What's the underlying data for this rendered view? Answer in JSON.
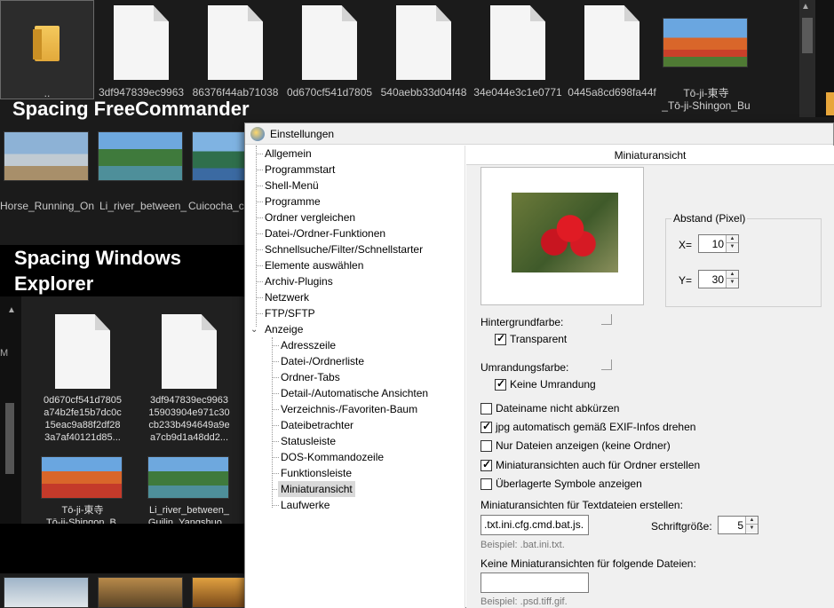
{
  "background": {
    "fc_items": [
      {
        "label": "..",
        "kind": "folder"
      },
      {
        "label": "3df947839ec9963",
        "kind": "doc"
      },
      {
        "label": "86376f44ab71038",
        "kind": "doc"
      },
      {
        "label": "0d670cf541d7805",
        "kind": "doc"
      },
      {
        "label": "540aebb33d04f48",
        "kind": "doc"
      },
      {
        "label": "34e044e3c1e0771",
        "kind": "doc"
      },
      {
        "label": "0445a8cd698fa44f",
        "kind": "doc"
      }
    ],
    "fc_pagoda_label_1": "Tō-ji-東寺",
    "fc_pagoda_label_2": "_Tō-ji-Shingon_Bu",
    "heading_freecommander": "Spacing FreeCommander",
    "row2_captions": [
      "Horse_Running_On",
      "Li_river_between_",
      "Cuicocha_c"
    ],
    "heading_windows_explorer_1": "Spacing Windows",
    "heading_windows_explorer_2": "Explorer",
    "we_side_letter": "M",
    "we_doc1_lines": [
      "0d670cf541d7805",
      "a74b2fe15b7dc0c",
      "15eac9a88f2df28",
      "3a7af40121d85..."
    ],
    "we_doc2_lines": [
      "3df947839ec9963",
      "15903904e971c30",
      "cb233b494649a9e",
      "a7cb9d1a48dd2..."
    ],
    "we_img1_lines": [
      "Tō-ji-東寺",
      "_Tō-ji-Shingon_B..."
    ],
    "we_img2_lines": [
      "Li_river_between_",
      "Guilin_Yangshuo..."
    ]
  },
  "dialog": {
    "title": "Einstellungen",
    "tree_top": [
      "Allgemein",
      "Programmstart",
      "Shell-Menü",
      "Programme",
      "Ordner vergleichen",
      "Datei-/Ordner-Funktionen",
      "Schnellsuche/Filter/Schnellstarter",
      "Elemente auswählen",
      "Archiv-Plugins",
      "Netzwerk",
      "FTP/SFTP"
    ],
    "tree_parent": "Anzeige",
    "tree_children": [
      "Adresszeile",
      "Datei-/Ordnerliste",
      "Ordner-Tabs",
      "Detail-/Automatische Ansichten",
      "Verzeichnis-/Favoriten-Baum",
      "Dateibetrachter",
      "Statusleiste",
      "DOS-Kommandozeile",
      "Funktionsleiste",
      "Miniaturansicht"
    ],
    "tree_last": "Laufwerke",
    "selected_item": "Miniaturansicht",
    "section_title": "Miniaturansicht",
    "spacing_group": "Abstand (Pixel)",
    "x_label": "X=",
    "x_value": "10",
    "y_label": "Y=",
    "y_value": "30",
    "bg_color_label": "Hintergrundfarbe:",
    "transparent_label": "Transparent",
    "transparent_checked": true,
    "border_color_label": "Umrandungsfarbe:",
    "no_border_label": "Keine Umrandung",
    "no_border_checked": true,
    "options": [
      {
        "label": "Dateiname nicht abkürzen",
        "checked": false
      },
      {
        "label": "jpg automatisch gemäß EXIF-Infos drehen",
        "checked": true
      },
      {
        "label": "Nur Dateien anzeigen (keine Ordner)",
        "checked": false
      },
      {
        "label": "Miniaturansichten auch für Ordner erstellen",
        "checked": true
      },
      {
        "label": "Überlagerte Symbole anzeigen",
        "checked": false
      }
    ],
    "text_thumbs_label": "Miniaturansichten für Textdateien erstellen:",
    "text_thumbs_value": ".txt.ini.cfg.cmd.bat.js.",
    "font_size_label": "Schriftgröße:",
    "font_size_value": "5",
    "example1": "Beispiel: .bat.ini.txt.",
    "exclude_label": "Keine Miniaturansichten für folgende Dateien:",
    "exclude_value": "",
    "example2": "Beispiel: .psd.tiff.gif."
  }
}
